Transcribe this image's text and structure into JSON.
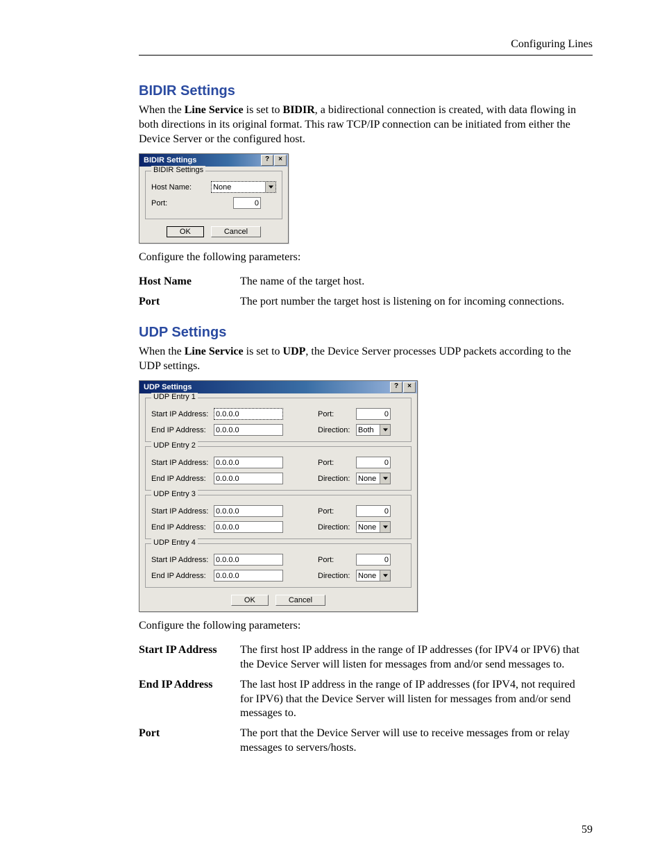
{
  "header": {
    "right": "Configuring Lines"
  },
  "footer": {
    "page_number": "59"
  },
  "section_bidir": {
    "heading": "BIDIR Settings",
    "intro_pre": "When the ",
    "term1": "Line Service",
    "intro_mid": " is set to ",
    "term2": "BIDIR",
    "intro_post": ", a bidirectional connection is created, with data flowing in both directions in its original format. This raw TCP/IP connection can be initiated from either the Device Server or the configured host.",
    "dialog": {
      "title": "BIDIR Settings",
      "group": "BIDIR Settings",
      "hostname_label": "Host Name:",
      "hostname_value": "None",
      "port_label": "Port:",
      "port_value": "0",
      "ok": "OK",
      "cancel": "Cancel"
    },
    "configure_text": "Configure the following parameters:",
    "params": {
      "hostname_key": "Host Name",
      "hostname_desc": "The name of the target host.",
      "port_key": "Port",
      "port_desc": "The port number the target host is listening on for incoming connections."
    }
  },
  "section_udp": {
    "heading": "UDP Settings",
    "intro_pre": "When the ",
    "term1": "Line Service",
    "intro_mid": " is set to ",
    "term2": "UDP",
    "intro_post": ", the Device Server processes UDP packets according to the UDP settings.",
    "dialog": {
      "title": "UDP Settings",
      "labels": {
        "start_ip": "Start IP Address:",
        "end_ip": "End IP Address:",
        "port": "Port:",
        "direction": "Direction:"
      },
      "entries": [
        {
          "group": "UDP Entry 1",
          "start_ip": "0.0.0.0",
          "end_ip": "0.0.0.0",
          "port": "0",
          "direction": "Both"
        },
        {
          "group": "UDP Entry 2",
          "start_ip": "0.0.0.0",
          "end_ip": "0.0.0.0",
          "port": "0",
          "direction": "None"
        },
        {
          "group": "UDP Entry 3",
          "start_ip": "0.0.0.0",
          "end_ip": "0.0.0.0",
          "port": "0",
          "direction": "None"
        },
        {
          "group": "UDP Entry 4",
          "start_ip": "0.0.0.0",
          "end_ip": "0.0.0.0",
          "port": "0",
          "direction": "None"
        }
      ],
      "ok": "OK",
      "cancel": "Cancel"
    },
    "configure_text": "Configure the following parameters:",
    "params": {
      "start_key": "Start IP Address",
      "start_desc": "The first host IP address in the range of IP addresses (for IPV4 or IPV6) that the Device Server will listen for messages from and/or send messages to.",
      "end_key": "End IP Address",
      "end_desc": "The last host IP address in the range of IP addresses (for IPV4, not required for IPV6) that the Device Server will listen for messages from and/or send messages to.",
      "port_key": "Port",
      "port_desc": "The port that the Device Server will use to receive messages from or relay messages to servers/hosts."
    }
  }
}
